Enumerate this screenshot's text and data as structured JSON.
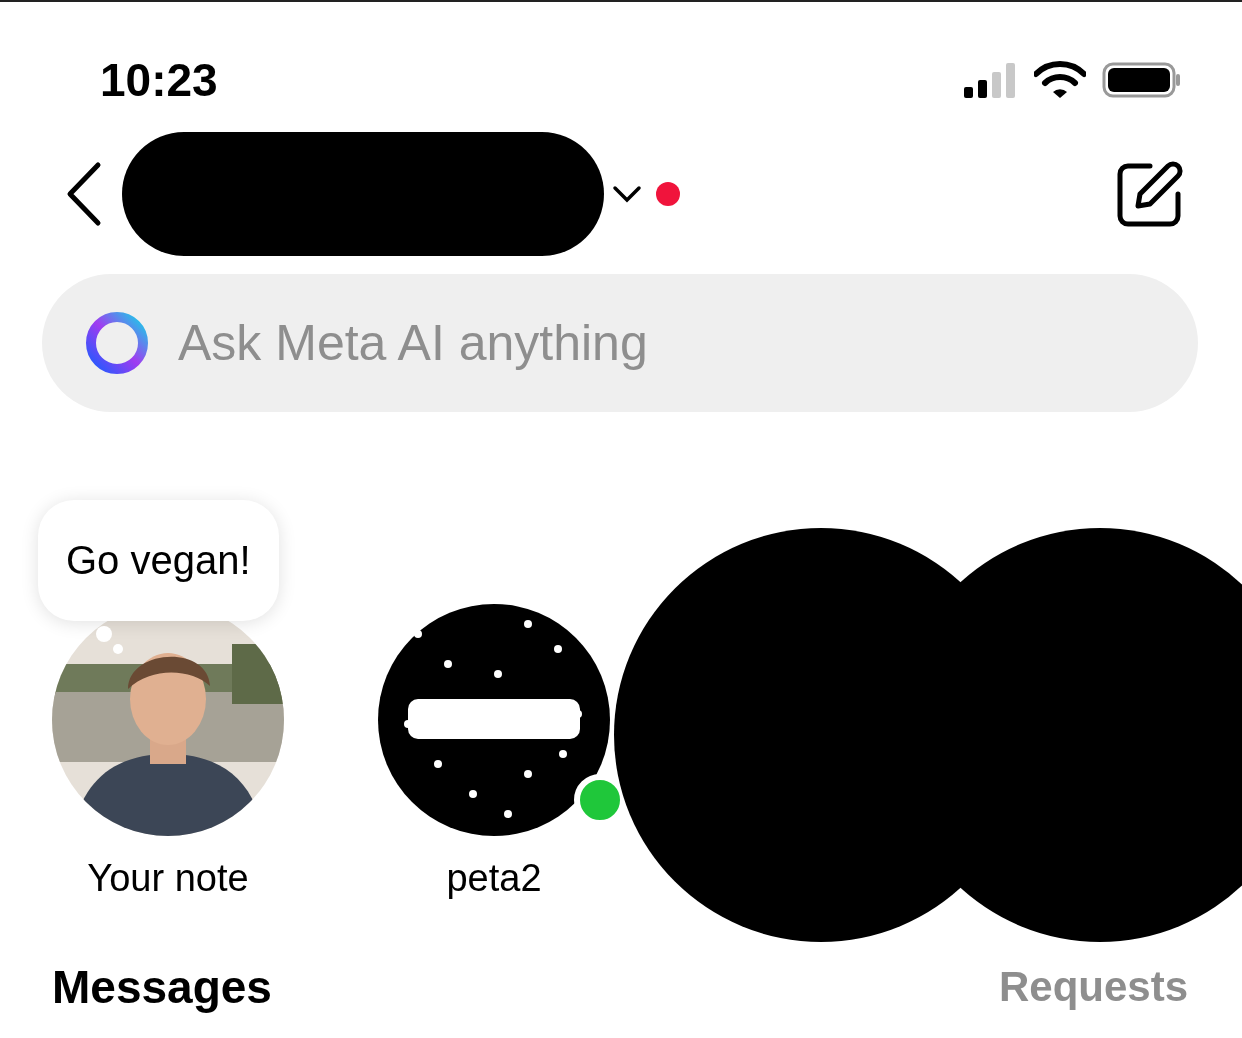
{
  "status_bar": {
    "time": "10:23"
  },
  "header": {
    "unread_dot": true
  },
  "search": {
    "placeholder": "Ask Meta AI anything"
  },
  "notes": [
    {
      "kind": "own",
      "note": "Go vegan!",
      "label": "Your note"
    },
    {
      "kind": "account",
      "label": "peta2",
      "online": true
    }
  ],
  "section": {
    "title": "Messages",
    "link": "Requests"
  }
}
